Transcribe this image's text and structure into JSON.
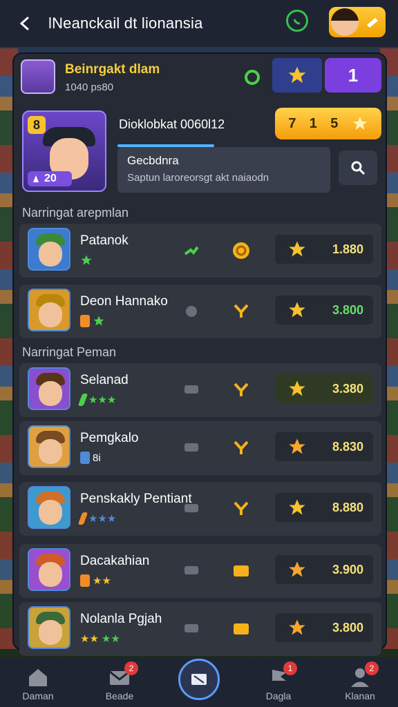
{
  "header": {
    "title": "lNeanckail dt lionansia"
  },
  "player": {
    "name": "Beinrgakt dlam",
    "sub": "1040 ps80",
    "rank_value": "1"
  },
  "hero": {
    "id_text": "Dioklobkat 0060l12",
    "badge": "8",
    "level": "20",
    "coins": [
      "7",
      "1",
      "5"
    ]
  },
  "search": {
    "label": "Gecbdnra",
    "hint": "Saptun laroreorsgt akt naiaodn"
  },
  "sections": [
    {
      "title": "Narringat arepmlan"
    },
    {
      "title": "Narringat Peman"
    }
  ],
  "items": [
    {
      "name": "Patanok",
      "tags": "",
      "score": "1.880"
    },
    {
      "name": "Deon Hannako",
      "tags": "",
      "score": "3.800"
    },
    {
      "name": "Selanad",
      "tags": "",
      "score": "3.380"
    },
    {
      "name": "Pemgkalo",
      "tags": "8i",
      "score": "8.830"
    },
    {
      "name": "Penskakly Pentiant",
      "tags": "",
      "score": "8.880"
    },
    {
      "name": "Dacakahian",
      "tags": "",
      "score": "3.900"
    },
    {
      "name": "Nolanla Pgjah",
      "tags": "",
      "score": "3.800"
    }
  ],
  "nav": [
    {
      "label": "Daman",
      "badge": ""
    },
    {
      "label": "Beade",
      "badge": "2"
    },
    {
      "label": "Dagla",
      "badge": "1"
    },
    {
      "label": "Klanan",
      "badge": "2"
    }
  ],
  "colors": {
    "accent": "#7b3fe0",
    "coin": "#f5b21a",
    "star": "#f6c22d",
    "score_green": "#65e06a"
  },
  "icons": [
    "back-icon",
    "whatsapp-icon",
    "search-icon",
    "star-icon",
    "home-icon",
    "mail-icon",
    "flag-icon",
    "user-icon"
  ]
}
